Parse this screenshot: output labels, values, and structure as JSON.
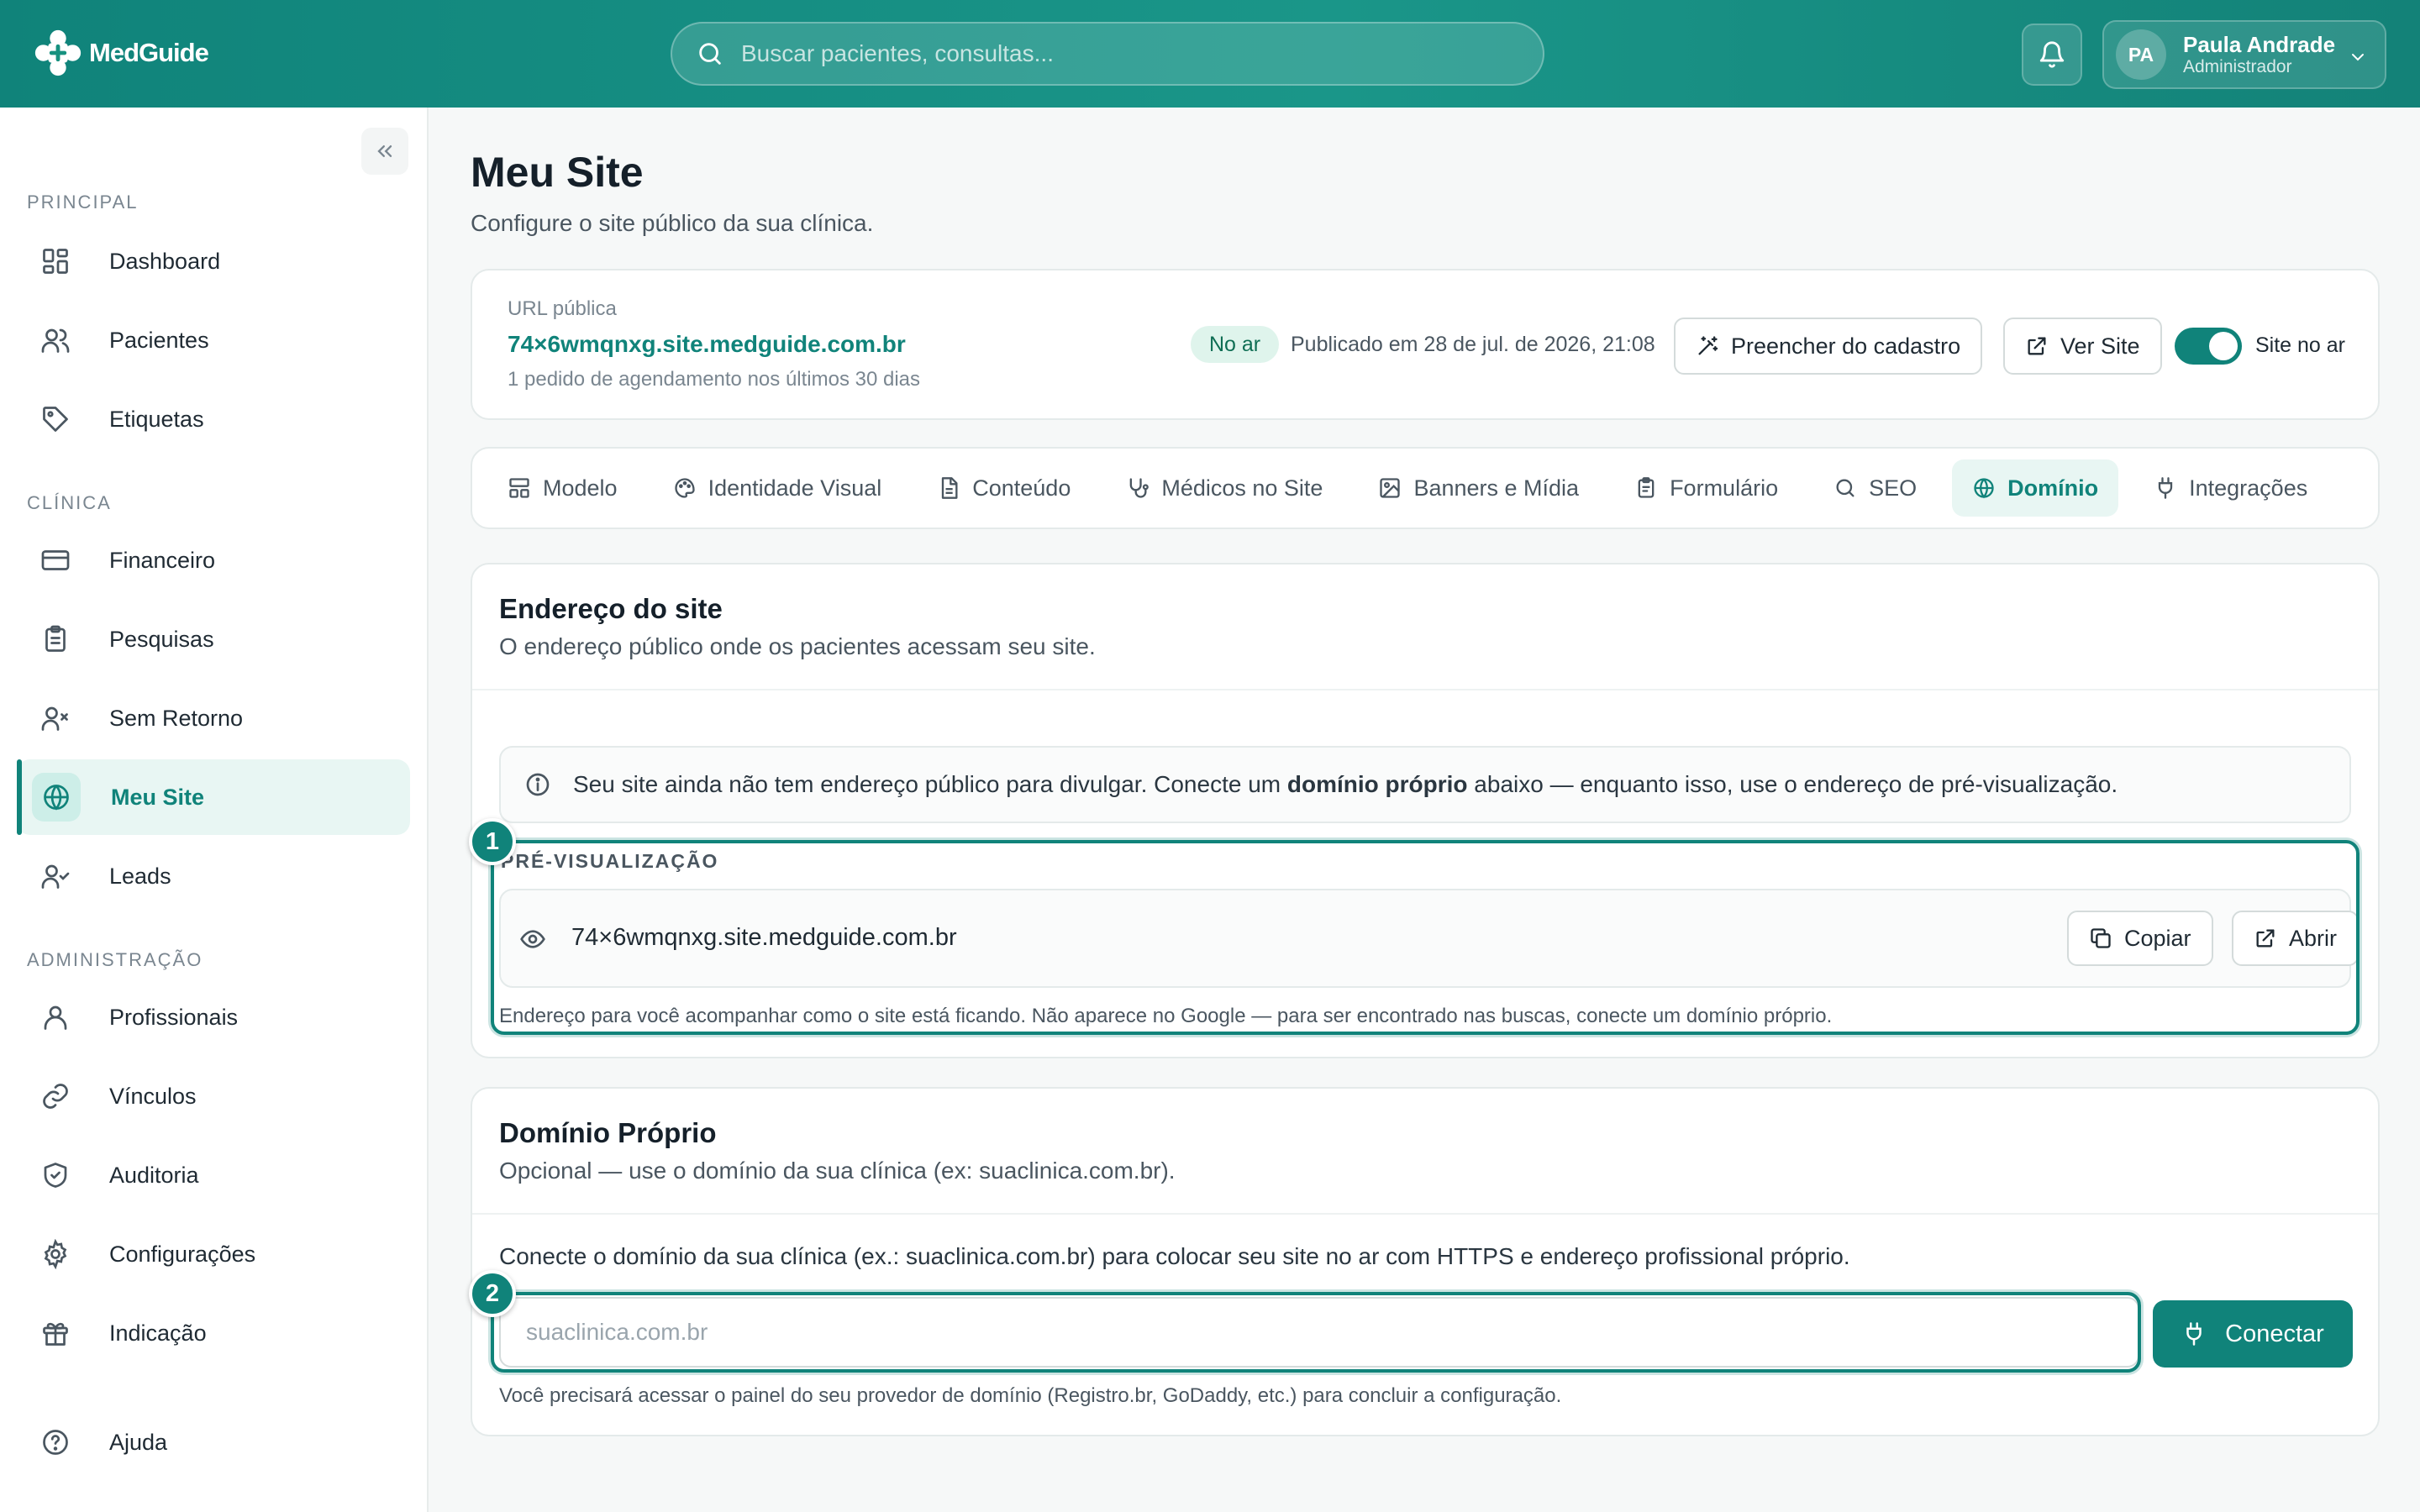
{
  "app": {
    "name": "MedGuide"
  },
  "colors": {
    "accent": "#10837a",
    "accent_light": "#e8f6f3",
    "success_badge_bg": "#dff4ec"
  },
  "header": {
    "search_placeholder": "Buscar pacientes, consultas...",
    "user": {
      "initials": "PA",
      "name": "Paula Andrade",
      "role": "Administrador"
    }
  },
  "sidebar": {
    "sections": [
      {
        "label": "PRINCIPAL",
        "items": [
          {
            "label": "Dashboard",
            "icon": "layout-dashboard-icon"
          },
          {
            "label": "Pacientes",
            "icon": "users-icon"
          },
          {
            "label": "Etiquetas",
            "icon": "tag-icon"
          }
        ]
      },
      {
        "label": "CLÍNICA",
        "items": [
          {
            "label": "Financeiro",
            "icon": "credit-card-icon"
          },
          {
            "label": "Pesquisas",
            "icon": "clipboard-icon"
          },
          {
            "label": "Sem Retorno",
            "icon": "user-x-icon"
          },
          {
            "label": "Meu Site",
            "icon": "globe-icon",
            "active": true
          },
          {
            "label": "Leads",
            "icon": "user-check-icon"
          }
        ]
      },
      {
        "label": "ADMINISTRAÇÃO",
        "items": [
          {
            "label": "Profissionais",
            "icon": "user-icon"
          },
          {
            "label": "Vínculos",
            "icon": "link-icon"
          },
          {
            "label": "Auditoria",
            "icon": "shield-icon"
          },
          {
            "label": "Configurações",
            "icon": "gear-icon"
          },
          {
            "label": "Indicação",
            "icon": "gift-icon"
          }
        ]
      }
    ],
    "help": {
      "label": "Ajuda",
      "icon": "help-circle-icon"
    }
  },
  "page": {
    "title": "Meu Site",
    "subtitle": "Configure o site público da sua clínica."
  },
  "url_card": {
    "label": "URL pública",
    "url": "74×6wmqnxg.site.medguide.com.br",
    "meta": "1 pedido de agendamento nos últimos 30 dias",
    "status_badge": "No ar",
    "published": "Publicado em 28 de jul. de 2026, 21:08",
    "fill_button": "Preencher do cadastro",
    "view_button": "Ver Site",
    "toggle_label": "Site no ar",
    "toggle_on": true
  },
  "tabs": [
    {
      "label": "Modelo",
      "icon": "layout-icon"
    },
    {
      "label": "Identidade Visual",
      "icon": "palette-icon"
    },
    {
      "label": "Conteúdo",
      "icon": "file-text-icon"
    },
    {
      "label": "Médicos no Site",
      "icon": "stethoscope-icon"
    },
    {
      "label": "Banners e Mídia",
      "icon": "image-icon"
    },
    {
      "label": "Formulário",
      "icon": "clipboard-list-icon"
    },
    {
      "label": "SEO",
      "icon": "search-icon"
    },
    {
      "label": "Domínio",
      "icon": "globe-icon",
      "active": true
    },
    {
      "label": "Integrações",
      "icon": "plug-icon"
    }
  ],
  "endereco": {
    "title": "Endereço do site",
    "subtitle": "O endereço público onde os pacientes acessam seu site.",
    "info_pre": "Seu site ainda não tem endereço público para divulgar. Conecte um ",
    "info_bold": "domínio próprio",
    "info_post": " abaixo — enquanto isso, use o endereço de pré-visualização.",
    "preview_label": "PRÉ-VISUALIZAÇÃO",
    "preview_url": "74×6wmqnxg.site.medguide.com.br",
    "copy_button": "Copiar",
    "open_button": "Abrir",
    "preview_note": "Endereço para você acompanhar como o site está ficando. Não aparece no Google — para ser encontrado nas buscas, conecte um domínio próprio."
  },
  "dominio": {
    "title": "Domínio Próprio",
    "subtitle": "Opcional — use o domínio da sua clínica (ex: suaclinica.com.br).",
    "text": "Conecte o domínio da sua clínica (ex.: suaclinica.com.br) para colocar seu site no ar com HTTPS e endereço profissional próprio.",
    "input_placeholder": "suaclinica.com.br",
    "input_value": "",
    "connect_button": "Conectar",
    "note": "Você precisará acessar o painel do seu provedor de domínio (Registro.br, GoDaddy, etc.) para concluir a configuração."
  },
  "steps": [
    "1",
    "2"
  ]
}
